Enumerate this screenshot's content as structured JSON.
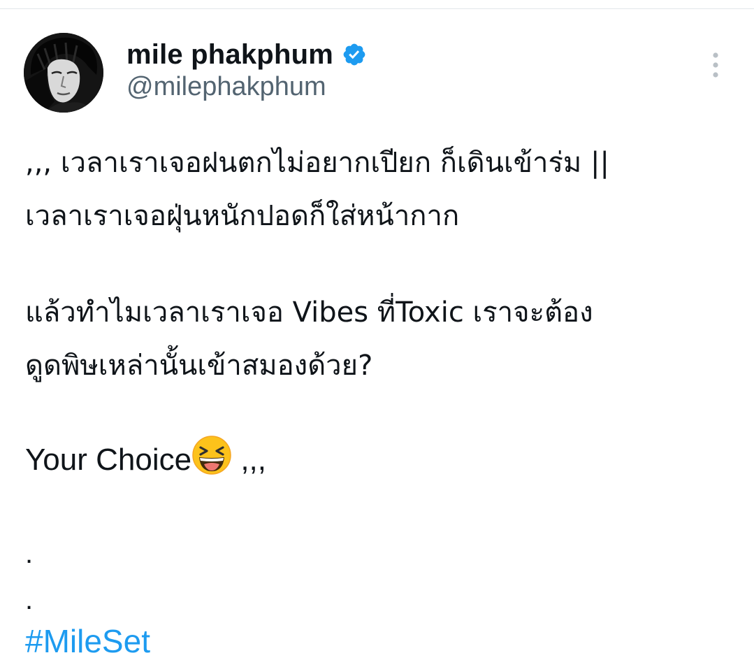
{
  "author": {
    "display_name": "mile phakphum",
    "handle": "@milephakphum",
    "verified_icon": "verified-badge-icon",
    "verified_color": "#1d9bf0"
  },
  "menu_icon": "more-vertical-icon",
  "post": {
    "line1": ",,, เวลาเราเจอฝนตกไม่อยากเปียก ก็เดินเข้าร่ม ||",
    "line2": "เวลาเราเจอฝุ่นหนักปอดก็ใส่หน้ากาก",
    "line3": "แล้วทำไมเวลาเราเจอ Vibes ที่Toxic เราจะต้อง",
    "line4": "ดูดพิษเหล่านั้นเข้าสมองด้วย?",
    "line5_text": "Your Choice",
    "line5_emoji": "laughing-squinting-face-emoji",
    "line5_suffix": " ,,,",
    "dot1": ".",
    "dot2": ".",
    "hashtag": "#MileSet"
  },
  "colors": {
    "text": "#0f1419",
    "secondary": "#536471",
    "link": "#1d9bf0",
    "divider": "#e1e6ea"
  }
}
